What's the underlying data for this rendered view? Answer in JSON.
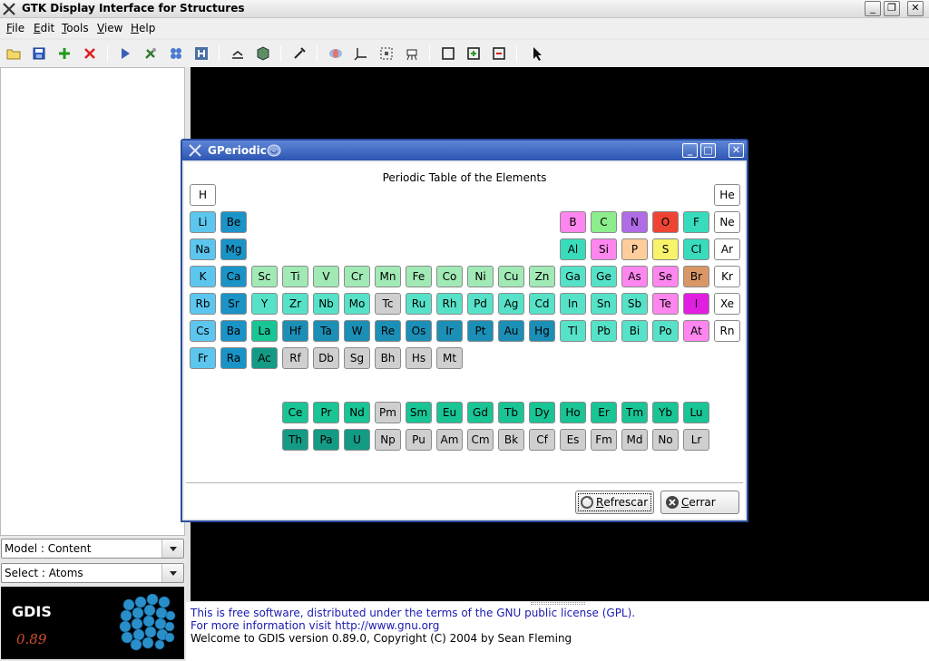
{
  "window": {
    "title": "GTK Display Interface for Structures",
    "controls": [
      "_",
      "❐",
      "✕"
    ]
  },
  "menu": [
    {
      "accel": "F",
      "rest": "ile"
    },
    {
      "accel": "E",
      "rest": "dit"
    },
    {
      "accel": "T",
      "rest": "ools"
    },
    {
      "accel": "V",
      "rest": "iew"
    },
    {
      "accel": "H",
      "rest": "elp"
    }
  ],
  "toolbar": {
    "icons": [
      "open-folder-icon",
      "save-icon",
      "add-icon",
      "delete-icon",
      "play-icon",
      "tools-icon",
      "molecule-icon",
      "hydrogen-icon",
      "measure-icon",
      "crystal-icon",
      "dropper-icon",
      "surface-icon",
      "axes-icon",
      "select-region-icon",
      "animation-icon",
      "box-icon",
      "zoom-in-icon",
      "zoom-out-icon",
      "pointer-icon"
    ]
  },
  "left_panel": {
    "model_combo": "Model : Content",
    "select_combo": "Select : Atoms",
    "logo_text": "GDIS",
    "logo_version": "0.89"
  },
  "status": {
    "line1": "This is free software, distributed under the terms of the GNU public license (GPL).",
    "line2": "For more information visit http://www.gnu.org",
    "line3": "Welcome to GDIS version 0.89.0, Copyright (C) 2004 by Sean Fleming"
  },
  "dialog": {
    "title": "GPeriodic",
    "controls": [
      "_",
      "□",
      "✕"
    ],
    "table_title": "Periodic Table of the Elements",
    "refresh_accel": "R",
    "refresh_rest": "efrescar",
    "close_accel": "C",
    "close_rest": "errar"
  },
  "colors": {
    "nonmetal_white": "#ffffff",
    "alkali": "#5cc6ee",
    "alkaline_earth": "#1a93c7",
    "transition_light": "#a1eab6",
    "transition_dark": "#1c8fb6",
    "post_transition": "#56e2c8",
    "lanthanide": "#19c495",
    "actinide": "#139b86",
    "synthetic_gray": "#cfcfcf",
    "boron_pink": "#ff86ee",
    "carbon_green": "#8ced8c",
    "nitrogen_purple": "#b06be6",
    "oxygen_red": "#ee4433",
    "halogen_teal": "#38dcbc",
    "phosphorus_peach": "#ffcd9b",
    "sulfur_yellow": "#f8f36a",
    "bromine_brown": "#d99766",
    "iodine_magenta": "#e21ee2"
  },
  "elements": [
    {
      "s": "H",
      "c": "nonmetal_white"
    },
    {
      "s": "He",
      "c": "nonmetal_white"
    },
    {
      "s": "Li",
      "c": "alkali"
    },
    {
      "s": "Be",
      "c": "alkaline_earth"
    },
    {
      "s": "B",
      "c": "boron_pink"
    },
    {
      "s": "C",
      "c": "carbon_green"
    },
    {
      "s": "N",
      "c": "nitrogen_purple"
    },
    {
      "s": "O",
      "c": "oxygen_red"
    },
    {
      "s": "F",
      "c": "halogen_teal"
    },
    {
      "s": "Ne",
      "c": "nonmetal_white"
    },
    {
      "s": "Na",
      "c": "alkali"
    },
    {
      "s": "Mg",
      "c": "alkaline_earth"
    },
    {
      "s": "Al",
      "c": "halogen_teal"
    },
    {
      "s": "Si",
      "c": "boron_pink"
    },
    {
      "s": "P",
      "c": "phosphorus_peach"
    },
    {
      "s": "S",
      "c": "sulfur_yellow"
    },
    {
      "s": "Cl",
      "c": "halogen_teal"
    },
    {
      "s": "Ar",
      "c": "nonmetal_white"
    },
    {
      "s": "K",
      "c": "alkali"
    },
    {
      "s": "Ca",
      "c": "alkaline_earth"
    },
    {
      "s": "Sc",
      "c": "transition_light"
    },
    {
      "s": "Ti",
      "c": "transition_light"
    },
    {
      "s": "V",
      "c": "transition_light"
    },
    {
      "s": "Cr",
      "c": "transition_light"
    },
    {
      "s": "Mn",
      "c": "transition_light"
    },
    {
      "s": "Fe",
      "c": "transition_light"
    },
    {
      "s": "Co",
      "c": "transition_light"
    },
    {
      "s": "Ni",
      "c": "transition_light"
    },
    {
      "s": "Cu",
      "c": "transition_light"
    },
    {
      "s": "Zn",
      "c": "transition_light"
    },
    {
      "s": "Ga",
      "c": "post_transition"
    },
    {
      "s": "Ge",
      "c": "post_transition"
    },
    {
      "s": "As",
      "c": "boron_pink"
    },
    {
      "s": "Se",
      "c": "boron_pink"
    },
    {
      "s": "Br",
      "c": "bromine_brown"
    },
    {
      "s": "Kr",
      "c": "nonmetal_white"
    },
    {
      "s": "Rb",
      "c": "alkali"
    },
    {
      "s": "Sr",
      "c": "alkaline_earth"
    },
    {
      "s": "Y",
      "c": "post_transition"
    },
    {
      "s": "Zr",
      "c": "post_transition"
    },
    {
      "s": "Nb",
      "c": "post_transition"
    },
    {
      "s": "Mo",
      "c": "post_transition"
    },
    {
      "s": "Tc",
      "c": "synthetic_gray"
    },
    {
      "s": "Ru",
      "c": "post_transition"
    },
    {
      "s": "Rh",
      "c": "post_transition"
    },
    {
      "s": "Pd",
      "c": "post_transition"
    },
    {
      "s": "Ag",
      "c": "post_transition"
    },
    {
      "s": "Cd",
      "c": "post_transition"
    },
    {
      "s": "In",
      "c": "post_transition"
    },
    {
      "s": "Sn",
      "c": "post_transition"
    },
    {
      "s": "Sb",
      "c": "post_transition"
    },
    {
      "s": "Te",
      "c": "boron_pink"
    },
    {
      "s": "I",
      "c": "iodine_magenta"
    },
    {
      "s": "Xe",
      "c": "nonmetal_white"
    },
    {
      "s": "Cs",
      "c": "alkali"
    },
    {
      "s": "Ba",
      "c": "alkaline_earth"
    },
    {
      "s": "La",
      "c": "lanthanide"
    },
    {
      "s": "Hf",
      "c": "transition_dark"
    },
    {
      "s": "Ta",
      "c": "transition_dark"
    },
    {
      "s": "W",
      "c": "transition_dark"
    },
    {
      "s": "Re",
      "c": "transition_dark"
    },
    {
      "s": "Os",
      "c": "transition_dark"
    },
    {
      "s": "Ir",
      "c": "transition_dark"
    },
    {
      "s": "Pt",
      "c": "transition_dark"
    },
    {
      "s": "Au",
      "c": "transition_dark"
    },
    {
      "s": "Hg",
      "c": "transition_dark"
    },
    {
      "s": "Tl",
      "c": "post_transition"
    },
    {
      "s": "Pb",
      "c": "post_transition"
    },
    {
      "s": "Bi",
      "c": "post_transition"
    },
    {
      "s": "Po",
      "c": "post_transition"
    },
    {
      "s": "At",
      "c": "boron_pink"
    },
    {
      "s": "Rn",
      "c": "nonmetal_white"
    },
    {
      "s": "Fr",
      "c": "alkali"
    },
    {
      "s": "Ra",
      "c": "alkaline_earth"
    },
    {
      "s": "Ac",
      "c": "actinide"
    },
    {
      "s": "Rf",
      "c": "synthetic_gray"
    },
    {
      "s": "Db",
      "c": "synthetic_gray"
    },
    {
      "s": "Sg",
      "c": "synthetic_gray"
    },
    {
      "s": "Bh",
      "c": "synthetic_gray"
    },
    {
      "s": "Hs",
      "c": "synthetic_gray"
    },
    {
      "s": "Mt",
      "c": "synthetic_gray"
    },
    {
      "s": "Ce",
      "c": "lanthanide"
    },
    {
      "s": "Pr",
      "c": "lanthanide"
    },
    {
      "s": "Nd",
      "c": "lanthanide"
    },
    {
      "s": "Pm",
      "c": "synthetic_gray"
    },
    {
      "s": "Sm",
      "c": "lanthanide"
    },
    {
      "s": "Eu",
      "c": "lanthanide"
    },
    {
      "s": "Gd",
      "c": "lanthanide"
    },
    {
      "s": "Tb",
      "c": "lanthanide"
    },
    {
      "s": "Dy",
      "c": "lanthanide"
    },
    {
      "s": "Ho",
      "c": "lanthanide"
    },
    {
      "s": "Er",
      "c": "lanthanide"
    },
    {
      "s": "Tm",
      "c": "lanthanide"
    },
    {
      "s": "Yb",
      "c": "lanthanide"
    },
    {
      "s": "Lu",
      "c": "lanthanide"
    },
    {
      "s": "Th",
      "c": "actinide"
    },
    {
      "s": "Pa",
      "c": "actinide"
    },
    {
      "s": "U",
      "c": "actinide"
    },
    {
      "s": "Np",
      "c": "synthetic_gray"
    },
    {
      "s": "Pu",
      "c": "synthetic_gray"
    },
    {
      "s": "Am",
      "c": "synthetic_gray"
    },
    {
      "s": "Cm",
      "c": "synthetic_gray"
    },
    {
      "s": "Bk",
      "c": "synthetic_gray"
    },
    {
      "s": "Cf",
      "c": "synthetic_gray"
    },
    {
      "s": "Es",
      "c": "synthetic_gray"
    },
    {
      "s": "Fm",
      "c": "synthetic_gray"
    },
    {
      "s": "Md",
      "c": "synthetic_gray"
    },
    {
      "s": "No",
      "c": "synthetic_gray"
    },
    {
      "s": "Lr",
      "c": "synthetic_gray"
    }
  ]
}
